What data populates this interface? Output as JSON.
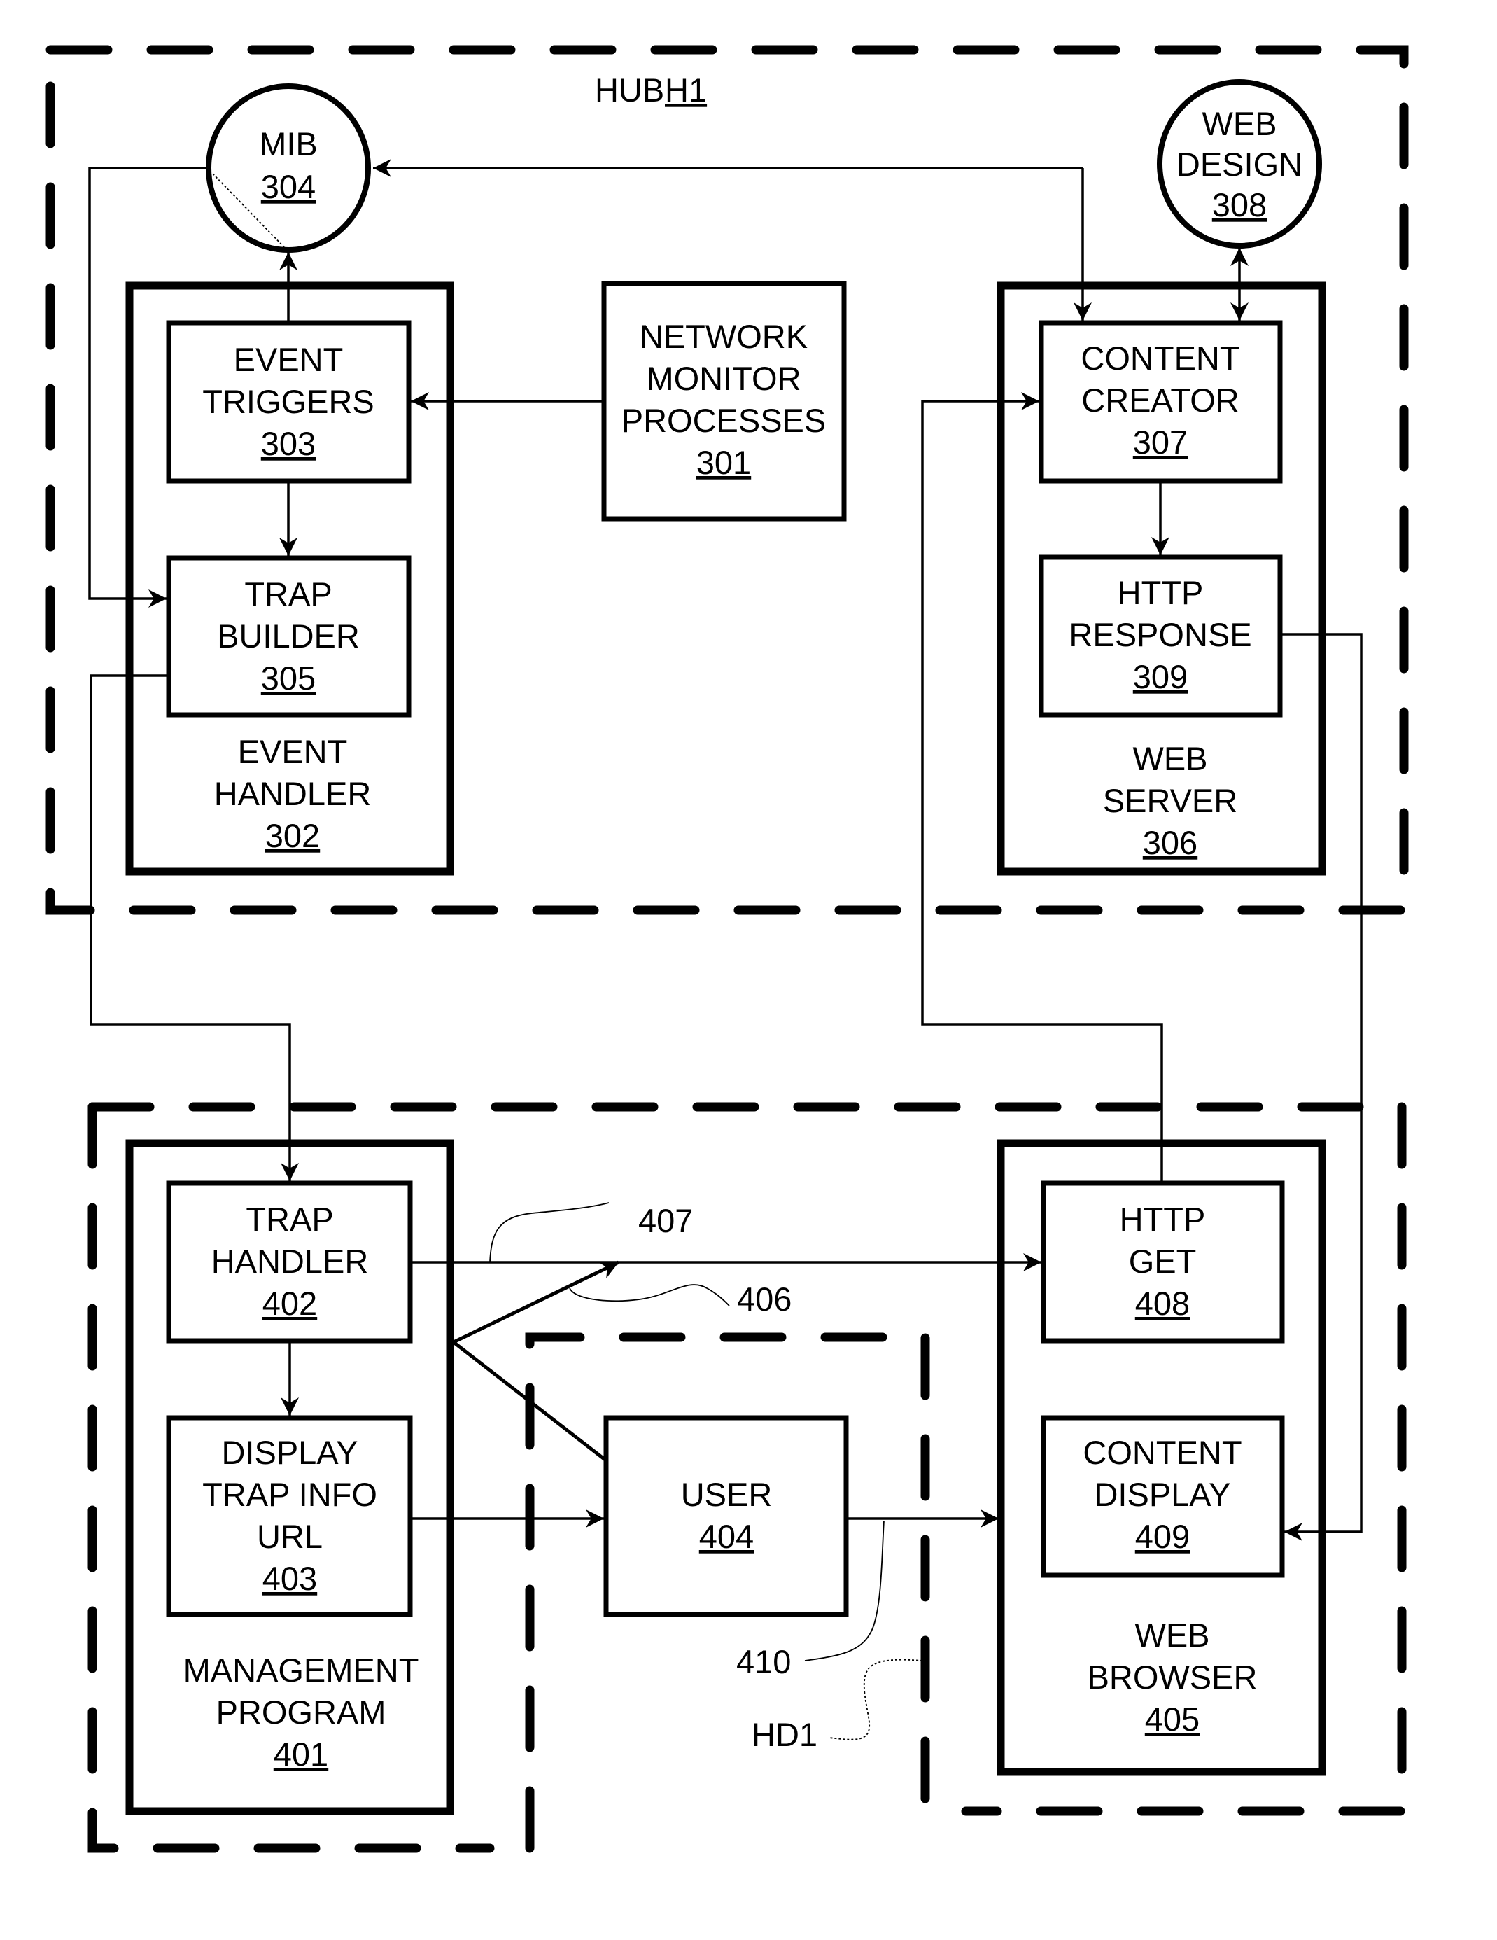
{
  "figure": {
    "hub": {
      "title": "HUB",
      "id": "H1"
    },
    "hub_components": {
      "mib": {
        "lines": [
          "MIB"
        ],
        "ref": "304"
      },
      "web_design": {
        "lines": [
          "WEB",
          "DESIGN"
        ],
        "ref": "308"
      },
      "network_monitor": {
        "lines": [
          "NETWORK",
          "MONITOR",
          "PROCESSES"
        ],
        "ref": "301"
      },
      "event_triggers": {
        "lines": [
          "EVENT",
          "TRIGGERS"
        ],
        "ref": "303"
      },
      "trap_builder": {
        "lines": [
          "TRAP",
          "BUILDER"
        ],
        "ref": "305"
      },
      "event_handler": {
        "lines": [
          "EVENT",
          "HANDLER"
        ],
        "ref": "302"
      },
      "content_creator": {
        "lines": [
          "CONTENT",
          "CREATOR"
        ],
        "ref": "307"
      },
      "http_response": {
        "lines": [
          "HTTP",
          "RESPONSE"
        ],
        "ref": "309"
      },
      "web_server": {
        "lines": [
          "WEB",
          "SERVER"
        ],
        "ref": "306"
      }
    },
    "client_components": {
      "trap_handler": {
        "lines": [
          "TRAP",
          "HANDLER"
        ],
        "ref": "402"
      },
      "display_trap_info": {
        "lines": [
          "DISPLAY",
          "TRAP INFO",
          "URL"
        ],
        "ref": "403"
      },
      "management_program": {
        "lines": [
          "MANAGEMENT",
          "PROGRAM"
        ],
        "ref": "401"
      },
      "user": {
        "lines": [
          "USER"
        ],
        "ref": "404"
      },
      "http_get": {
        "lines": [
          "HTTP",
          "GET"
        ],
        "ref": "408"
      },
      "content_display": {
        "lines": [
          "CONTENT",
          "DISPLAY"
        ],
        "ref": "409"
      },
      "web_browser": {
        "lines": [
          "WEB",
          "BROWSER"
        ],
        "ref": "405"
      }
    },
    "callouts": {
      "c407": "407",
      "c406": "406",
      "c410": "410",
      "hd1": "HD1"
    }
  }
}
